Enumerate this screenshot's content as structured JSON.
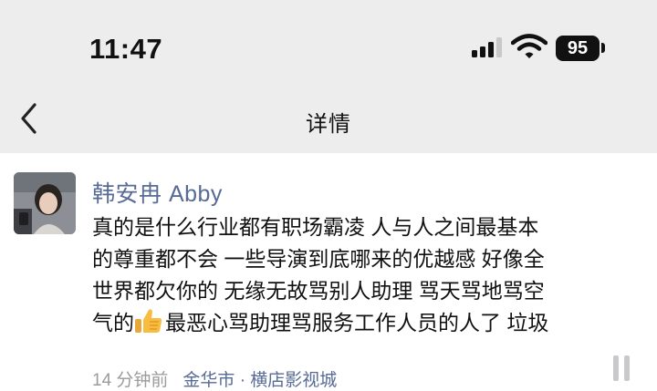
{
  "status_bar": {
    "time": "11:47",
    "battery": "95",
    "icons": [
      "cellular-signal-icon",
      "wifi-icon",
      "battery-icon"
    ]
  },
  "nav": {
    "back_icon": "chevron-left-icon",
    "title": "详情"
  },
  "post": {
    "author": "韩安冉 Abby",
    "lines": [
      "真的是什么行业都有职场霸凌 人与人之间最基本",
      "的尊重都不会  一些导演到底哪来的优越感 好像全",
      "世界都欠你的 无缘无故骂别人助理 骂天骂地骂空",
      "气的",
      "最恶心骂助理骂服务工作人员的人了 垃圾"
    ],
    "emoji": "thumbs-up-icon",
    "time_ago": "14 分钟前",
    "location": "金华市 · 横店影视城",
    "more_icon": "more-options-icon"
  },
  "colors": {
    "header_bg": "#ededed",
    "author_link": "#576b95",
    "meta_gray": "#9b9b9b"
  }
}
